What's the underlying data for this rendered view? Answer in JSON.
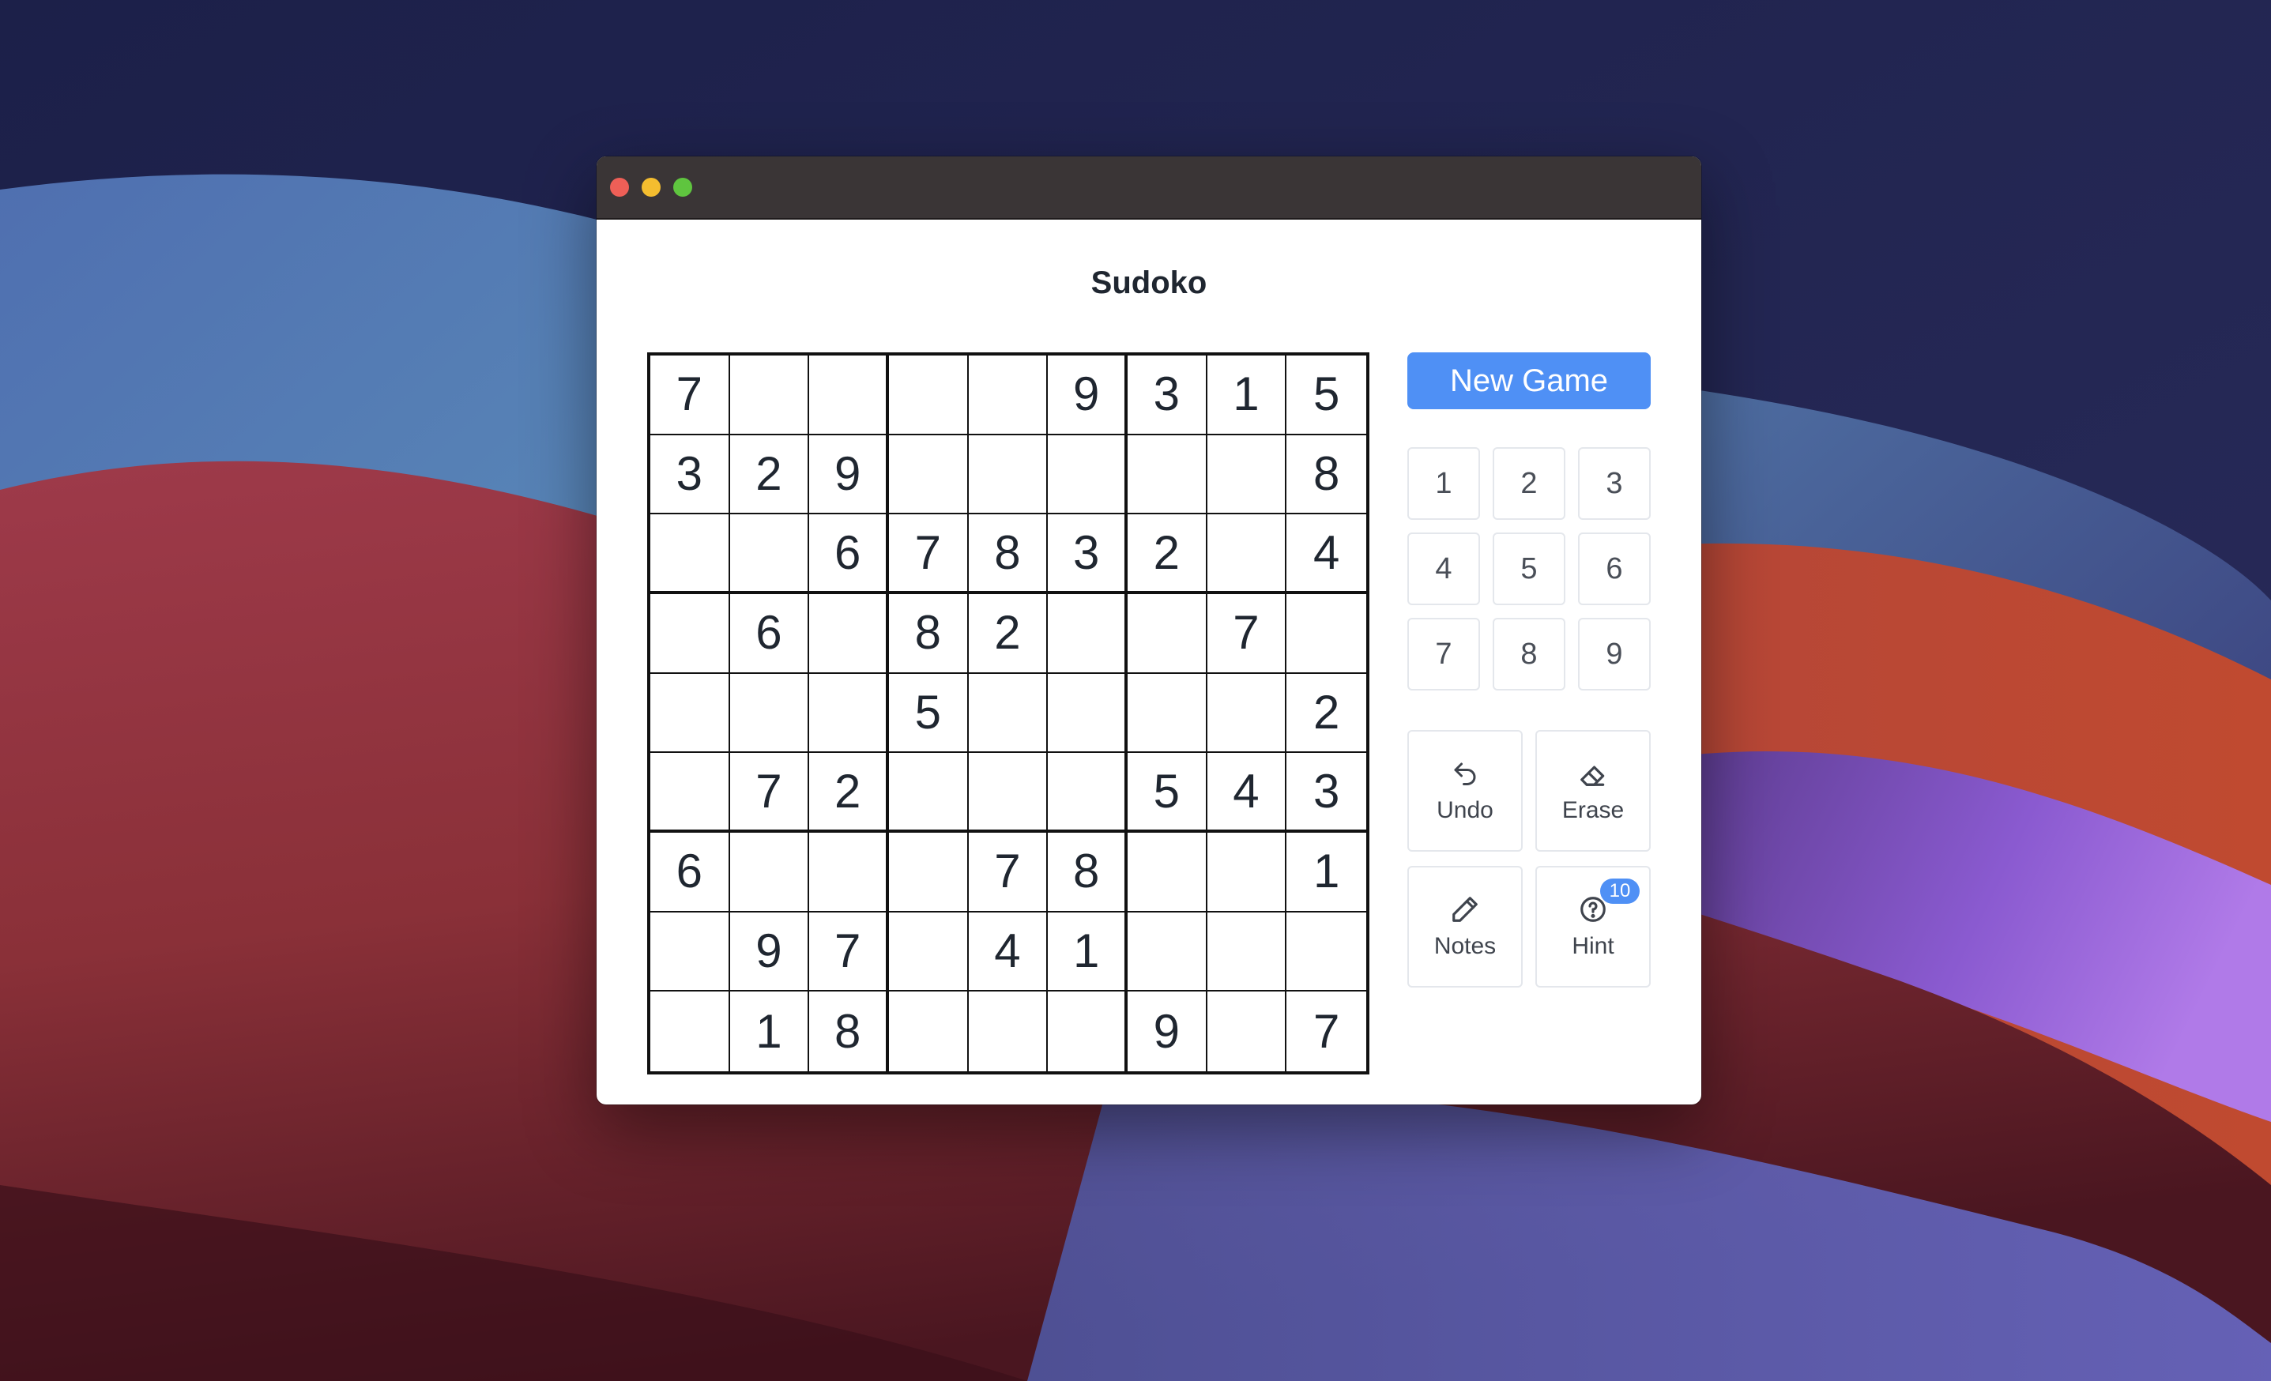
{
  "app": {
    "title": "Sudoko"
  },
  "board": {
    "grid": [
      [
        "7",
        "",
        "",
        "",
        "",
        "9",
        "3",
        "1",
        "5"
      ],
      [
        "3",
        "2",
        "9",
        "",
        "",
        "",
        "",
        "",
        "8"
      ],
      [
        "",
        "",
        "6",
        "7",
        "8",
        "3",
        "2",
        "",
        "4"
      ],
      [
        "",
        "6",
        "",
        "8",
        "2",
        "",
        "",
        "7",
        ""
      ],
      [
        "",
        "",
        "",
        "5",
        "",
        "",
        "",
        "",
        "2"
      ],
      [
        "",
        "7",
        "2",
        "",
        "",
        "",
        "5",
        "4",
        "3"
      ],
      [
        "6",
        "",
        "",
        "",
        "7",
        "8",
        "",
        "",
        "1"
      ],
      [
        "",
        "9",
        "7",
        "",
        "4",
        "1",
        "",
        "",
        ""
      ],
      [
        "",
        "1",
        "8",
        "",
        "",
        "",
        "9",
        "",
        "7"
      ]
    ]
  },
  "controls": {
    "new_game_label": "New Game",
    "numpad": [
      "1",
      "2",
      "3",
      "4",
      "5",
      "6",
      "7",
      "8",
      "9"
    ],
    "undo_label": "Undo",
    "erase_label": "Erase",
    "notes_label": "Notes",
    "hint_label": "Hint",
    "hint_count": "10"
  },
  "colors": {
    "accent": "#4f90f5",
    "titlebar": "#3a3536",
    "text": "#1f2630"
  },
  "icons": {
    "undo": "undo-arrow-icon",
    "erase": "eraser-icon",
    "notes": "pencil-icon",
    "hint": "question-circle-icon"
  }
}
